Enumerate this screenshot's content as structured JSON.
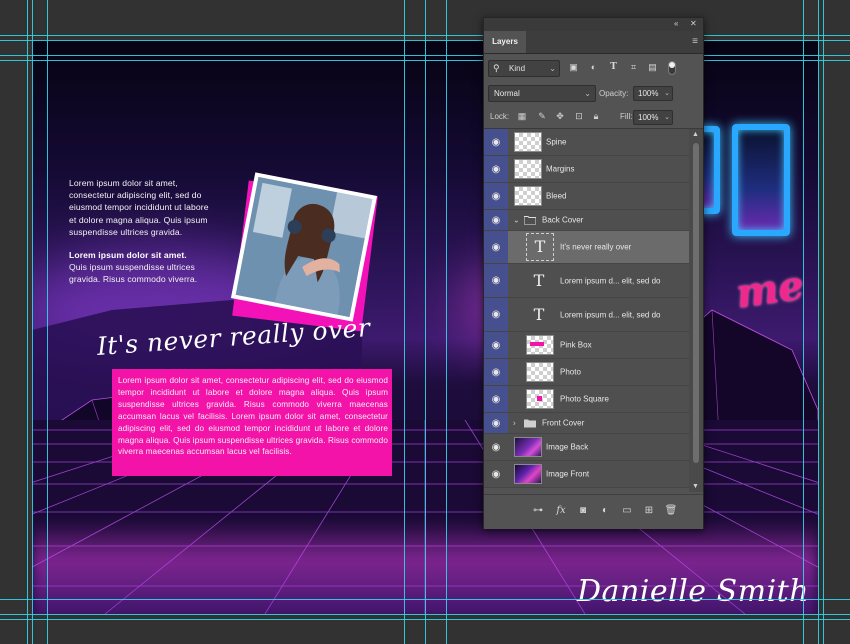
{
  "canvas": {
    "back_cover": {
      "paragraph1": "Lorem ipsum dolor sit amet, consectetur adipiscing elit, sed do eiusmod tempor incididunt ut labore et dolore magna aliqua. Quis ipsum suspendisse ultrices gravida.",
      "paragraph2_bold": "Lorem ipsum dolor sit amet.",
      "paragraph2": "Quis ipsum suspendisse ultrices gravida. Risus commodo viverra.",
      "script_title": "It's never really over",
      "pink_box_text": "Lorem ipsum dolor sit amet, consectetur adipiscing elit, sed do eiusmod tempor incididunt ut labore et dolore magna aliqua. Quis ipsum suspendisse ultrices gravida. Risus commodo viverra maecenas accumsan lacus vel facilisis. Lorem ipsum dolor sit amet, consectetur adipiscing elit, sed do eiusmod tempor incididunt ut labore et dolore magna aliqua. Quis ipsum suspendisse ultrices gravida. Risus commodo viverra maecenas accumsan lacus vel facilisis."
    },
    "front_cover": {
      "author": "Danielle Smith",
      "title_fragment": "me"
    },
    "colors": {
      "accent_pink": "#f313a8",
      "guide_cyan": "#31d6e8",
      "neon_blue": "#2aa8ff"
    }
  },
  "layers_panel": {
    "tab_label": "Layers",
    "filter": {
      "kind_label": "Kind",
      "icons": [
        "image-filter-icon",
        "adjustment-filter-icon",
        "type-filter-icon",
        "shape-filter-icon",
        "smart-object-filter-icon"
      ]
    },
    "blend_mode": "Normal",
    "opacity_label": "Opacity:",
    "opacity_value": "100%",
    "lock_label": "Lock:",
    "fill_label": "Fill:",
    "fill_value": "100%",
    "layers": [
      {
        "name": "Spine",
        "kind": "pixel",
        "indent": 0
      },
      {
        "name": "Margins",
        "kind": "pixel",
        "indent": 0
      },
      {
        "name": "Bleed",
        "kind": "pixel",
        "indent": 0
      },
      {
        "name": "Back Cover",
        "kind": "group",
        "indent": 0,
        "expanded": true
      },
      {
        "name": "It's never really over",
        "kind": "text",
        "indent": 1,
        "selected": true
      },
      {
        "name": "Lorem ipsum d... elit, sed do",
        "kind": "text",
        "indent": 1
      },
      {
        "name": "Lorem ipsum d... elit, sed do",
        "kind": "text",
        "indent": 1
      },
      {
        "name": "Pink Box",
        "kind": "pixel",
        "indent": 1
      },
      {
        "name": "Photo",
        "kind": "pixel",
        "indent": 1
      },
      {
        "name": "Photo Square",
        "kind": "pixel",
        "indent": 1
      },
      {
        "name": "Front Cover",
        "kind": "group",
        "indent": 0,
        "expanded": false
      },
      {
        "name": "Image Back",
        "kind": "image",
        "indent": 0
      },
      {
        "name": "Image Front",
        "kind": "image",
        "indent": 0
      }
    ],
    "footer_buttons": [
      "link-layers-icon",
      "fx-icon",
      "add-mask-icon",
      "adjustment-layer-icon",
      "new-group-icon",
      "new-layer-icon",
      "delete-layer-icon"
    ]
  }
}
